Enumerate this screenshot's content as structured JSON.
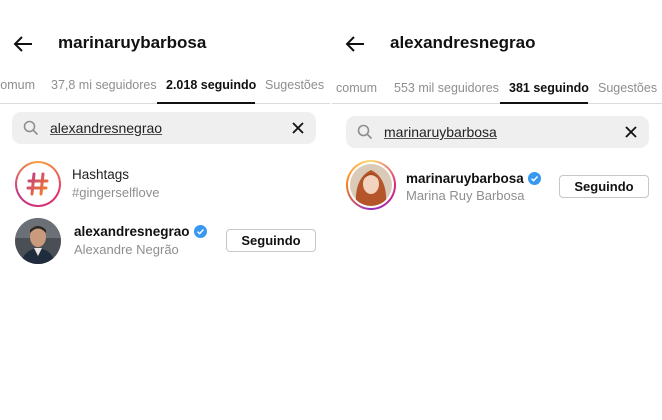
{
  "left": {
    "username": "marinaruybarbosa",
    "tabs": [
      {
        "label": "comum",
        "active": false
      },
      {
        "label": "37,8 mi seguidores",
        "active": false
      },
      {
        "label": "2.018 seguindo",
        "active": true
      },
      {
        "label": "Sugestões",
        "active": false
      }
    ],
    "search_value": "alexandresnegrao",
    "results": [
      {
        "type": "hashtag",
        "primary": "Hashtags",
        "secondary": "#gingerselflove"
      },
      {
        "type": "user",
        "primary": "alexandresnegrao",
        "secondary": "Alexandre Negrão",
        "verified": true,
        "button": "Seguindo"
      }
    ]
  },
  "right": {
    "username": "alexandresnegrao",
    "tabs": [
      {
        "label": "comum",
        "active": false
      },
      {
        "label": "553 mil seguidores",
        "active": false
      },
      {
        "label": "381 seguindo",
        "active": true
      },
      {
        "label": "Sugestões",
        "active": false
      }
    ],
    "search_value": "marinaruybarbosa",
    "results": [
      {
        "type": "user",
        "primary": "marinaruybarbosa",
        "secondary": "Marina Ruy Barbosa",
        "verified": true,
        "button": "Seguindo"
      }
    ]
  },
  "colors": {
    "verified": "#3897f0",
    "active_tab": "#111111",
    "muted": "#8e8e8e"
  },
  "icons": [
    "back-arrow-icon",
    "search-icon",
    "clear-icon",
    "verified-badge-icon",
    "hashtag-icon"
  ]
}
